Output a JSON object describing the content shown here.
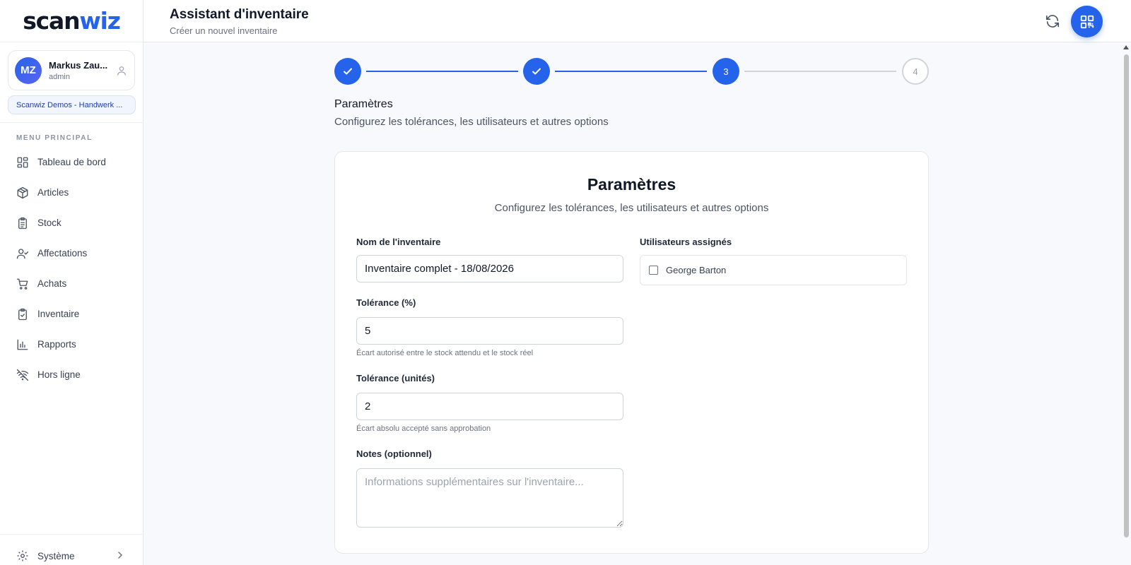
{
  "brand": {
    "logo_part1": "scan",
    "logo_part2": "wiz",
    "accent": "#2563eb"
  },
  "user": {
    "initials": "MZ",
    "name": "Markus Zau...",
    "role": "admin"
  },
  "organization": "Scanwiz Demos - Handwerk ...",
  "sidebar": {
    "heading": "MENU PRINCIPAL",
    "items": [
      {
        "label": "Tableau de bord",
        "icon": "dashboard-icon"
      },
      {
        "label": "Articles",
        "icon": "box-icon"
      },
      {
        "label": "Stock",
        "icon": "clipboard-list-icon"
      },
      {
        "label": "Affectations",
        "icon": "user-check-icon"
      },
      {
        "label": "Achats",
        "icon": "cart-icon"
      },
      {
        "label": "Inventaire",
        "icon": "clipboard-check-icon"
      },
      {
        "label": "Rapports",
        "icon": "bar-chart-icon"
      },
      {
        "label": "Hors ligne",
        "icon": "wifi-off-icon"
      }
    ],
    "system_label": "Système"
  },
  "header": {
    "title": "Assistant d'inventaire",
    "subtitle": "Créer un nouvel inventaire"
  },
  "stepper": {
    "steps": [
      {
        "label": "1",
        "state": "done"
      },
      {
        "label": "2",
        "state": "done"
      },
      {
        "label": "3",
        "state": "active"
      },
      {
        "label": "4",
        "state": "pending"
      }
    ]
  },
  "section": {
    "title": "Paramètres",
    "subtitle": "Configurez les tolérances, les utilisateurs et autres options"
  },
  "card": {
    "title": "Paramètres",
    "subtitle": "Configurez les tolérances, les utilisateurs et autres options"
  },
  "form": {
    "name_label": "Nom de l'inventaire",
    "name_value": "Inventaire complet - 18/08/2026",
    "tol_pct_label": "Tolérance (%)",
    "tol_pct_value": "5",
    "tol_pct_help": "Écart autorisé entre le stock attendu et le stock réel",
    "tol_units_label": "Tolérance (unités)",
    "tol_units_value": "2",
    "tol_units_help": "Écart absolu accepté sans approbation",
    "notes_label": "Notes (optionnel)",
    "notes_placeholder": "Informations supplémentaires sur l'inventaire...",
    "users_label": "Utilisateurs assignés",
    "users": [
      {
        "name": "George Barton",
        "checked": false
      }
    ]
  }
}
